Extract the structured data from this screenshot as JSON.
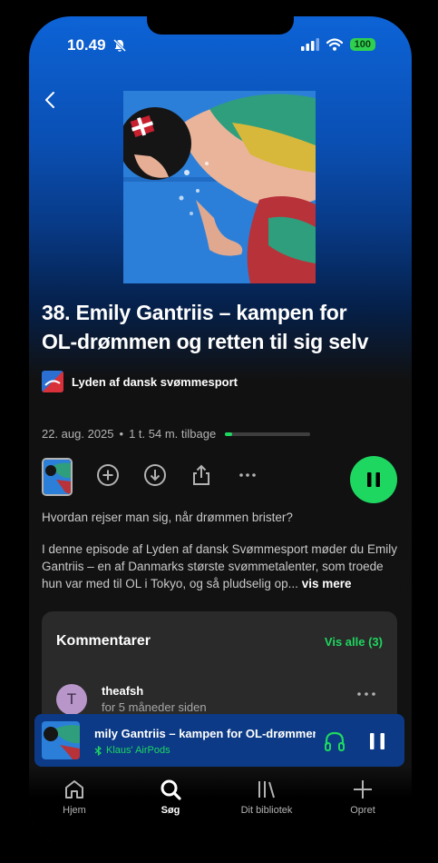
{
  "status_bar": {
    "time": "10.49",
    "battery": "100"
  },
  "episode": {
    "title": "38. Emily Gantriis – kampen for OL-drømmen og retten til sig selv",
    "show_name": "Lyden af dansk svømmesport",
    "date": "22. aug. 2025",
    "remaining": "1 t. 54 m. tilbage",
    "progress_fraction": 0.08,
    "description_line1": "Hvordan rejser man sig, når drømmen brister?",
    "description_body": "I denne episode af Lyden af dansk Svømmesport møder du Emily Gantriis – en af Danmarks største svømmetalenter, som troede hun var med til OL i Tokyo, og så pludselig op...",
    "more_label": "vis mere"
  },
  "comments": {
    "title": "Kommentarer",
    "see_all": "Vis alle (3)",
    "first": {
      "avatar_letter": "T",
      "user": "theafsh",
      "time": "for 5 måneder siden"
    }
  },
  "player": {
    "title": "mily Gantriis – kampen for OL-drømmen og retten",
    "device": "Klaus' AirPods"
  },
  "nav": {
    "home": "Hjem",
    "search": "Søg",
    "library": "Dit bibliotek",
    "create": "Opret"
  },
  "colors": {
    "accent": "#1ed760",
    "player_bg": "#0c3a86",
    "header_blue": "#0d63d6"
  }
}
